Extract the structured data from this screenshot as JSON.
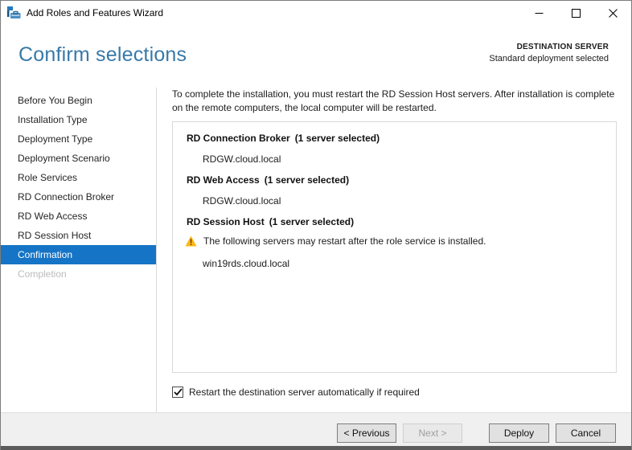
{
  "window": {
    "title": "Add Roles and Features Wizard"
  },
  "header": {
    "title": "Confirm selections",
    "destination_label": "DESTINATION SERVER",
    "destination_value": "Standard deployment selected"
  },
  "sidebar": {
    "items": [
      "Before You Begin",
      "Installation Type",
      "Deployment Type",
      "Deployment Scenario",
      "Role Services",
      "RD Connection Broker",
      "RD Web Access",
      "RD Session Host",
      "Confirmation",
      "Completion"
    ],
    "active_item": "Confirmation",
    "disabled_item": "Completion"
  },
  "content": {
    "intro": "To complete the installation, you must restart the RD Session Host servers. After installation is complete on the remote computers, the local computer will be restarted.",
    "sections": [
      {
        "title": "RD Connection Broker",
        "count": "(1 server selected)",
        "servers": [
          "RDGW.cloud.local"
        ]
      },
      {
        "title": "RD Web Access",
        "count": "(1 server selected)",
        "servers": [
          "RDGW.cloud.local"
        ]
      },
      {
        "title": "RD Session Host",
        "count": "(1 server selected)",
        "warning": "The following servers may restart after the role service is installed.",
        "servers": [
          "win19rds.cloud.local"
        ]
      }
    ],
    "restart_checkbox": {
      "label": "Restart the destination server automatically if required",
      "checked": true
    }
  },
  "footer": {
    "previous": "< Previous",
    "next": "Next >",
    "deploy": "Deploy",
    "cancel": "Cancel"
  },
  "colors": {
    "accent_blue": "#1574c5",
    "heading_blue": "#3879a8",
    "warning_yellow": "#fcb817",
    "bottom_bar": "#5c5c5c"
  }
}
